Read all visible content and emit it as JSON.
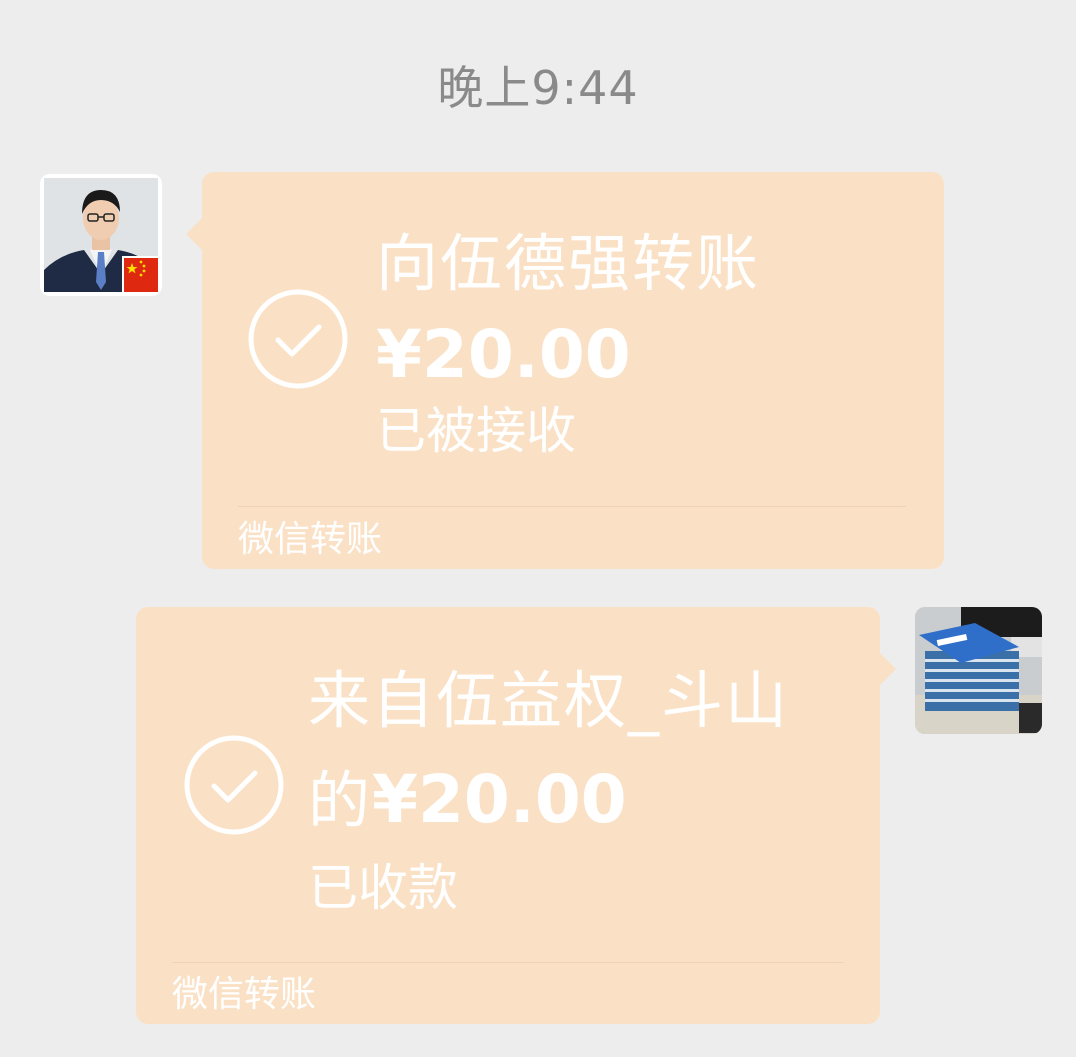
{
  "chat": {
    "timestamp": "晚上9:44",
    "messages": [
      {
        "side": "left",
        "title": "向伍德强转账",
        "amount": "¥20.00",
        "status": "已被接收",
        "footer": "微信转账"
      },
      {
        "side": "right",
        "title_line1": "来自伍益权_斗山",
        "title_line2_prefix": "的",
        "amount": "¥20.00",
        "status": "已收款",
        "footer": "微信转账"
      }
    ]
  },
  "icons": {
    "check": "check-circle-icon",
    "flag": "china-flag-icon"
  },
  "colors": {
    "background": "#ededed",
    "bubble": "#fae1c6",
    "text": "#ffffff",
    "timestamp": "#8a8a8a"
  }
}
